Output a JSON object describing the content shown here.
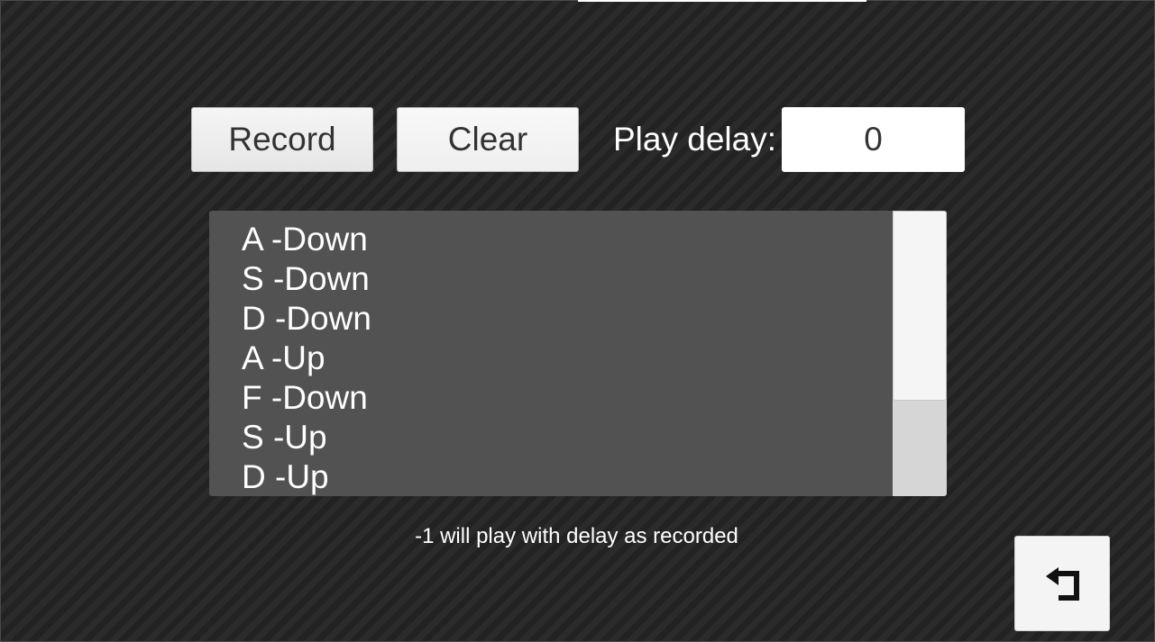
{
  "toolbar": {
    "record_label": "Record",
    "clear_label": "Clear",
    "delay_label": "Play delay:",
    "delay_value": "0"
  },
  "events": [
    {
      "label": "A -Down"
    },
    {
      "label": "S -Down"
    },
    {
      "label": "D -Down"
    },
    {
      "label": "A -Up"
    },
    {
      "label": "F -Down"
    },
    {
      "label": "S -Up"
    },
    {
      "label": "D -Up"
    }
  ],
  "hint": "-1 will play with delay as recorded",
  "back_icon": "back-arrow-icon"
}
